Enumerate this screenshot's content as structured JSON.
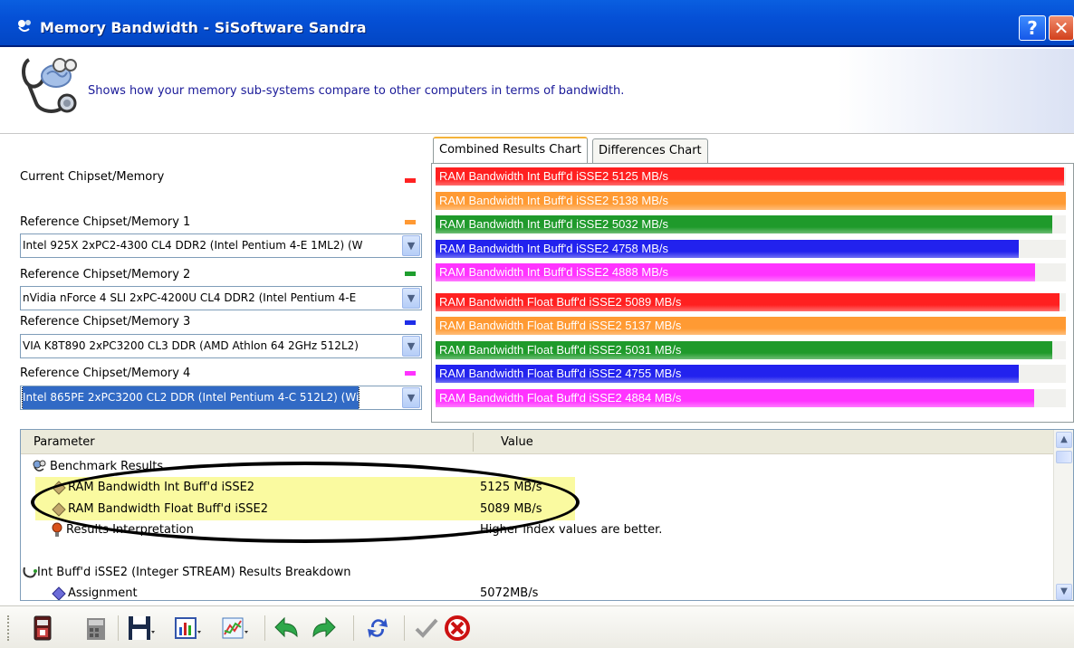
{
  "window": {
    "title": "Memory Bandwidth - SiSoftware Sandra",
    "help_label": "?",
    "close_label": "✕"
  },
  "header": {
    "description": "Shows how your memory sub-systems compare to other computers in terms of bandwidth."
  },
  "chipsets": {
    "current_label": "Current Chipset/Memory",
    "refs": [
      {
        "label": "Reference Chipset/Memory 1",
        "value": "Intel 925X 2xPC2-4300 CL4 DDR2 (Intel Pentium 4-E 1ML2) (W",
        "color": "#ff9933"
      },
      {
        "label": "Reference Chipset/Memory 2",
        "value": "nVidia nForce 4 SLI 2xPC-4200U CL4 DDR2 (Intel Pentium 4-E",
        "color": "#1e9e2e"
      },
      {
        "label": "Reference Chipset/Memory 3",
        "value": "VIA K8T890 2xPC3200 CL3 DDR (AMD Athlon 64 2GHz 512L2)",
        "color": "#1e2ee8"
      },
      {
        "label": "Reference Chipset/Memory 4",
        "value": "Intel 865PE 2xPC3200 CL2 DDR (Intel Pentium 4-C 512L2) (Wi",
        "color": "#ff33ff"
      }
    ],
    "current_color": "#ff2222"
  },
  "tabs": [
    {
      "label": "Combined Results Chart",
      "active": true
    },
    {
      "label": "Differences Chart",
      "active": false
    }
  ],
  "chart_data": {
    "type": "bar",
    "orientation": "horizontal",
    "max": 5140,
    "groups": [
      {
        "bars": [
          {
            "label": "RAM Bandwidth Int Buff'd iSSE2 5125 MB/s",
            "value": 5125,
            "color": "#ff2020"
          },
          {
            "label": "RAM Bandwidth Int Buff'd iSSE2 5138 MB/s",
            "value": 5138,
            "color": "#ff9a33"
          },
          {
            "label": "RAM Bandwidth Int Buff'd iSSE2 5032 MB/s",
            "value": 5032,
            "color": "#1f9a2b"
          },
          {
            "label": "RAM Bandwidth Int Buff'd iSSE2 4758 MB/s",
            "value": 4758,
            "color": "#2222ee"
          },
          {
            "label": "RAM Bandwidth Int Buff'd iSSE2 4888 MB/s",
            "value": 4888,
            "color": "#ff33ff"
          }
        ]
      },
      {
        "bars": [
          {
            "label": "RAM Bandwidth Float Buff'd iSSE2 5089 MB/s",
            "value": 5089,
            "color": "#ff2020"
          },
          {
            "label": "RAM Bandwidth Float Buff'd iSSE2 5137 MB/s",
            "value": 5137,
            "color": "#ff9a33"
          },
          {
            "label": "RAM Bandwidth Float Buff'd iSSE2 5031 MB/s",
            "value": 5031,
            "color": "#1f9a2b"
          },
          {
            "label": "RAM Bandwidth Float Buff'd iSSE2 4755 MB/s",
            "value": 4755,
            "color": "#2222ee"
          },
          {
            "label": "RAM Bandwidth Float Buff'd iSSE2 4884 MB/s",
            "value": 4884,
            "color": "#ff33ff"
          }
        ]
      }
    ]
  },
  "results": {
    "col_parameter": "Parameter",
    "col_value": "Value",
    "rows": [
      {
        "param": "Benchmark Results",
        "value": ""
      },
      {
        "param": "RAM Bandwidth Int Buff'd iSSE2",
        "value": "5125 MB/s"
      },
      {
        "param": "RAM Bandwidth Float Buff'd iSSE2",
        "value": "5089 MB/s"
      },
      {
        "param": "Results Interpretation",
        "value": "Higher index values are better."
      },
      {
        "param": "",
        "value": ""
      },
      {
        "param": "Int Buff'd iSSE2 (Integer STREAM) Results Breakdown",
        "value": ""
      },
      {
        "param": "Assignment",
        "value": "5072MB/s"
      }
    ]
  },
  "toolbar": {
    "icons": [
      "save-report-icon",
      "calculator-icon",
      "floppy-save-icon",
      "chart-icon",
      "line-graph-icon",
      "back-icon",
      "forward-icon",
      "refresh-icon",
      "ok-check-icon",
      "cancel-icon"
    ]
  }
}
